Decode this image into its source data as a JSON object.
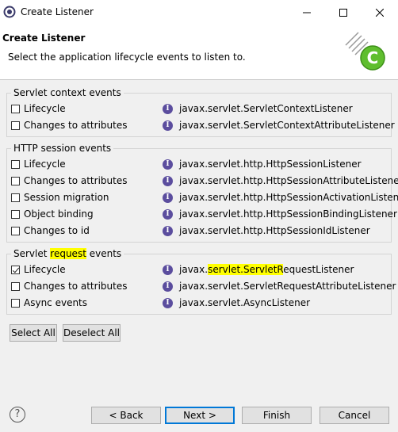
{
  "window": {
    "title": "Create Listener",
    "min_icon": "minimize-icon",
    "max_icon": "maximize-icon",
    "close_icon": "close-icon"
  },
  "header": {
    "title": "Create Listener",
    "description": "Select the application lifecycle events to listen to."
  },
  "groups": [
    {
      "title": "Servlet context events",
      "rows": [
        {
          "label": "Lifecycle",
          "checked": false,
          "class": "javax.servlet.ServletContextListener"
        },
        {
          "label": "Changes to attributes",
          "checked": false,
          "class": "javax.servlet.ServletContextAttributeListener"
        }
      ]
    },
    {
      "title": "HTTP session events",
      "rows": [
        {
          "label": "Lifecycle",
          "checked": false,
          "class": "javax.servlet.http.HttpSessionListener"
        },
        {
          "label": "Changes to attributes",
          "checked": false,
          "class": "javax.servlet.http.HttpSessionAttributeListener"
        },
        {
          "label": "Session migration",
          "checked": false,
          "class": "javax.servlet.http.HttpSessionActivationListener"
        },
        {
          "label": "Object binding",
          "checked": false,
          "class": "javax.servlet.http.HttpSessionBindingListener"
        },
        {
          "label": "Changes to id",
          "checked": false,
          "class": "javax.servlet.http.HttpSessionIdListener"
        }
      ]
    },
    {
      "title_pre": "Servlet ",
      "title_hl": "request",
      "title_post": " events",
      "rows": [
        {
          "label": "Lifecycle",
          "checked": true,
          "class_pre": "javax.",
          "class_hl": "servlet.ServletR",
          "class_post": "equestListener"
        },
        {
          "label": "Changes to attributes",
          "checked": false,
          "class": "javax.servlet.ServletRequestAttributeListener"
        },
        {
          "label": "Async events",
          "checked": false,
          "class": "javax.servlet.AsyncListener"
        }
      ]
    }
  ],
  "selection_buttons": {
    "select_all": "Select All",
    "deselect_all": "Deselect All"
  },
  "footer": {
    "help": "?",
    "back": "< Back",
    "next": "Next >",
    "finish": "Finish",
    "cancel": "Cancel"
  },
  "colors": {
    "highlight": "#ffff00",
    "interface_icon": "#5b4d9e",
    "default_button_border": "#0078d7"
  }
}
